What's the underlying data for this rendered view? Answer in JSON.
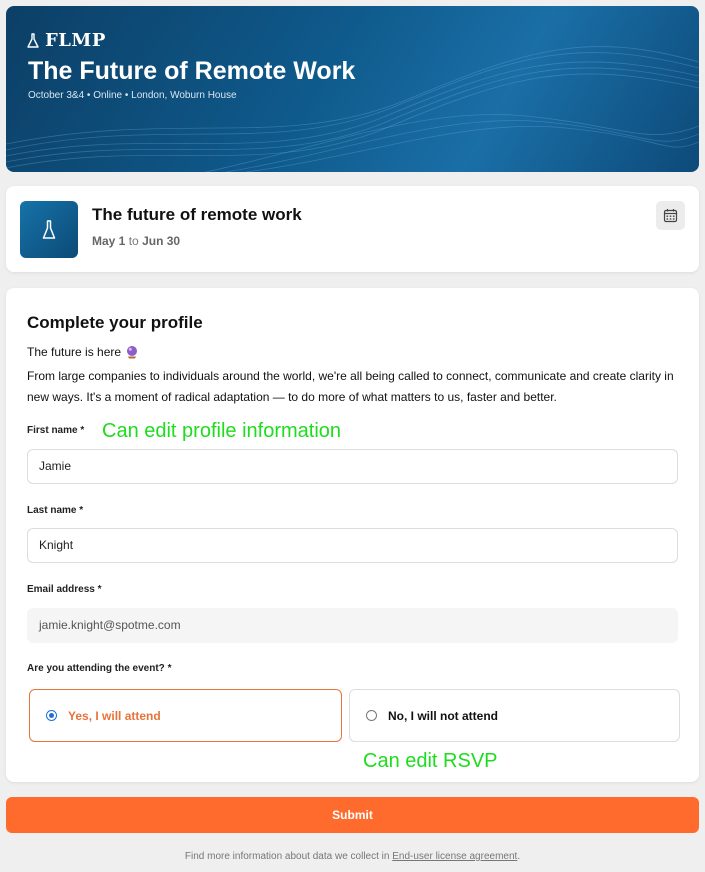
{
  "hero": {
    "brand": "FLMP",
    "title": "The Future of Remote Work",
    "subtitle": "October 3&4 • Online • London, Woburn House"
  },
  "event": {
    "title": "The future of remote work",
    "start": "May 1",
    "to": "to",
    "end": "Jun 30",
    "calendar_icon": "calendar-icon"
  },
  "form": {
    "heading": "Complete your profile",
    "intro_line1": "The future is here",
    "intro_line2": "From large companies to individuals around the world, we're all being called to connect, communicate and create clarity in new ways. It's a moment of radical adaptation — to do more of what matters to us, faster and better.",
    "first_name_label": "First name *",
    "first_name_value": "Jamie",
    "last_name_label": "Last name *",
    "last_name_value": "Knight",
    "email_label": "Email address *",
    "email_value": "jamie.knight@spotme.com",
    "attending_label": "Are you attending the event? *",
    "options": [
      {
        "label": "Yes, I will attend",
        "selected": true
      },
      {
        "label": "No, I will not attend",
        "selected": false
      }
    ]
  },
  "annotations": {
    "profile": "Can edit profile information",
    "rsvp": "Can edit RSVP"
  },
  "submit_label": "Submit",
  "footer": {
    "text": "Find more information about data we collect in",
    "link": "End-user license agreement",
    "end": "."
  },
  "colors": {
    "accent": "#ff6b2c",
    "selected_border": "#e8733a",
    "annotation": "#1edc1e",
    "hero": "#0f5a8c"
  }
}
